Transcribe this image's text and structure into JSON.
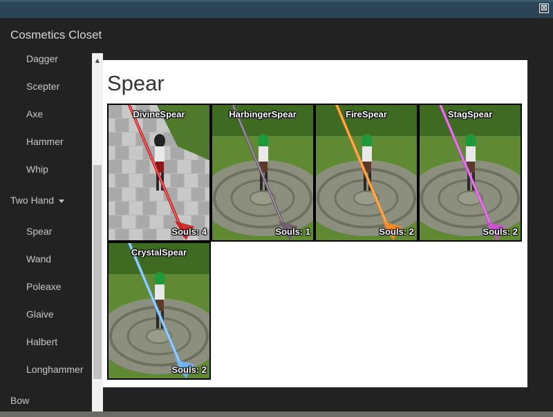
{
  "window": {
    "title": "Cosmetics Closet",
    "close_label": "⊠"
  },
  "sidebar": {
    "items": [
      {
        "label": "Dagger",
        "level": "sub"
      },
      {
        "label": "Scepter",
        "level": "sub"
      },
      {
        "label": "Axe",
        "level": "sub"
      },
      {
        "label": "Hammer",
        "level": "sub"
      },
      {
        "label": "Whip",
        "level": "sub"
      },
      {
        "label": "Two Hand",
        "level": "top",
        "expanded": true
      },
      {
        "label": "Spear",
        "level": "sub"
      },
      {
        "label": "Wand",
        "level": "sub"
      },
      {
        "label": "Poleaxe",
        "level": "sub"
      },
      {
        "label": "Glaive",
        "level": "sub"
      },
      {
        "label": "Halbert",
        "level": "sub"
      },
      {
        "label": "Longhammer",
        "level": "sub"
      },
      {
        "label": "Bow",
        "level": "top"
      }
    ]
  },
  "content": {
    "title": "Spear",
    "cards": [
      {
        "name": "DivineSpear",
        "souls": "Souls: 4",
        "glow": "#d01818"
      },
      {
        "name": "HarbingerSpear",
        "souls": "Souls: 1",
        "glow": "#6a5a6a"
      },
      {
        "name": "FireSpear",
        "souls": "Souls: 2",
        "glow": "#ff8a1a"
      },
      {
        "name": "StagSpear",
        "souls": "Souls: 2",
        "glow": "#d04ad8"
      },
      {
        "name": "CrystalSpear",
        "souls": "Souls: 2",
        "glow": "#6fb8ff"
      }
    ]
  },
  "colors": {
    "titlebar": "#2b4557",
    "window_bg": "#222222",
    "content_bg": "#ffffff",
    "nav_text": "#c8c8c8"
  }
}
